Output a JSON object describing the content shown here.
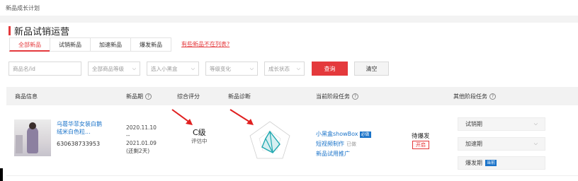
{
  "breadcrumb": "新品成长计划",
  "section_title": "新品试销运营",
  "tabs": [
    {
      "label": "全部新品",
      "active": true
    },
    {
      "label": "试销新品",
      "active": false
    },
    {
      "label": "加速新品",
      "active": false
    },
    {
      "label": "爆发新品",
      "active": false
    }
  ],
  "tab_link": "有些新品不在列表?",
  "filters": {
    "name_placeholder": "商品名/id",
    "level_placeholder": "全部商品等级",
    "blackbox_placeholder": "选入小黑盒",
    "grade_change_placeholder": "等级变化",
    "growth_status_placeholder": "成长状态",
    "query_label": "查询",
    "clear_label": "清空"
  },
  "table": {
    "headers": {
      "product_info": "商品信息",
      "new_period": "新品期",
      "overall_rating": "综合评分",
      "diagnosis": "新品诊断",
      "current_task": "当前阶段任务",
      "other_tasks": "其他阶段任务"
    },
    "row": {
      "title": "乌葛华菲女装白鹅绒米白色粒...",
      "id": "630638733953",
      "period_start": "2020.11.10",
      "period_sep": "--",
      "period_end": "2021.01.09",
      "remaining": "(还剩2天)",
      "grade": "C级",
      "grade_status": "评估中",
      "tasks": [
        {
          "label": "小黑盒showBox",
          "badge": "必做",
          "status": ""
        },
        {
          "label": "短视频制作",
          "badge": "",
          "status": "已做"
        },
        {
          "label": "新品试用推广",
          "badge": "",
          "status": ""
        }
      ],
      "pending_label": "待爆发",
      "open_badge": "开启",
      "stages": [
        {
          "label": "试销期",
          "badge": ""
        },
        {
          "label": "加速期",
          "badge": ""
        },
        {
          "label": "爆发期",
          "badge": "当前"
        }
      ]
    }
  },
  "colors": {
    "accent": "#e4393c",
    "link": "#1a73c9",
    "radar": "#1fa8b0",
    "arrow": "#e02020"
  }
}
